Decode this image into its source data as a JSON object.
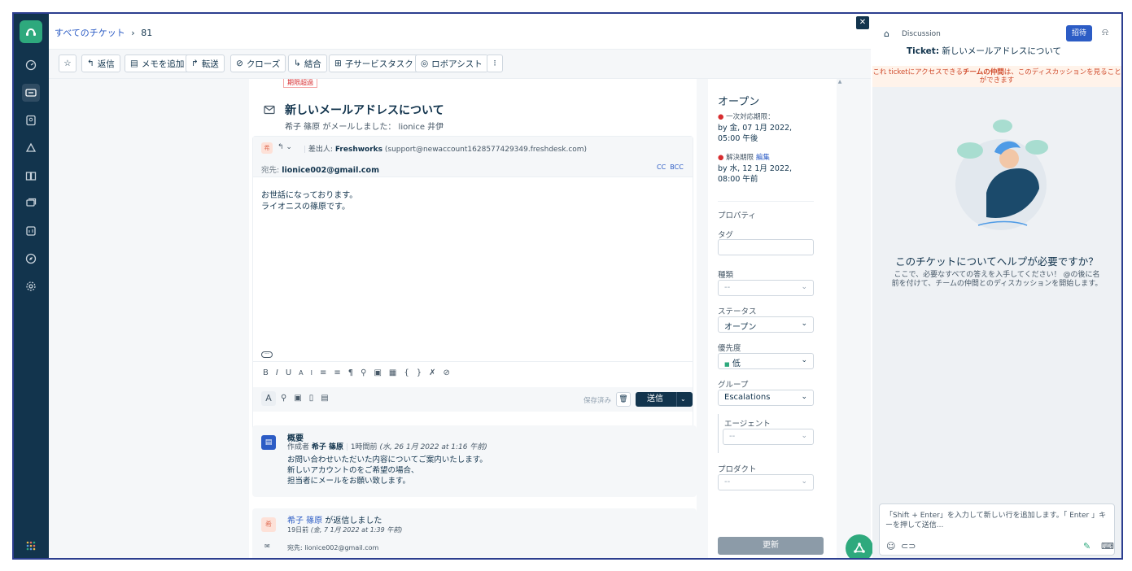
{
  "header": {
    "breadcrumb_all": "すべてのチケット",
    "breadcrumb_sep": "›",
    "ticket_number": "81"
  },
  "toolbar": {
    "reply": "返信",
    "add_note": "メモを追加",
    "forward": "転送",
    "close": "クローズ",
    "merge": "結合",
    "child_task": "子サービスタスク",
    "robo_assist": "ロボアシスト",
    "more": "⁝"
  },
  "ticket": {
    "overdue_badge": "期限超過",
    "subject": "新しいメールアドレスについて",
    "byline": "希子 篠原 がメールしました： lionice 井伊",
    "from_prefix": "差出人:",
    "from_name": "Freshworks",
    "from_email": "(support@newaccount1628577429349.freshdesk.com)",
    "to_label": "宛先:",
    "to_value": "lionice002@gmail.com",
    "cc": "CC",
    "bcc": "BCC",
    "body_line1": "お世話になっております。",
    "body_line2": "ライオニスの篠原です。",
    "saved": "保存済み",
    "send": "送信"
  },
  "summary": {
    "title": "概要",
    "author_prefix": "作成者",
    "author": "希子 篠原",
    "time": "1時間前",
    "time_detail": "(水, 26 1月 2022 at 1:16 午前)",
    "line1": "お問い合わせいただいた内容についてご案内いたします。",
    "line2": "新しいアカウントのをご希望の場合、",
    "line3": "担当者にメールをお願い致します。"
  },
  "reply_entry": {
    "author": "希子 篠原",
    "action": "が返信しました",
    "time": "19日前",
    "time_detail": "(金, 7 1月 2022 at 1:39 午前)",
    "to": "宛先: lionice002@gmail.com"
  },
  "properties": {
    "status_title": "オープン",
    "first_response_label": "一次対応期限：",
    "first_response_value": "by 金, 07 1月 2022, 05:00 午後",
    "resolution_label": "解決期限",
    "edit": "編集",
    "resolution_value": "by 水, 12 1月 2022, 08:00 午前",
    "section": "プロパティ",
    "tag_label": "タグ",
    "type_label": "種類",
    "type_value": "--",
    "status_label": "ステータス",
    "status_value": "オープン",
    "priority_label": "優先度",
    "priority_value": "低",
    "group_label": "グループ",
    "group_value": "Escalations",
    "agent_label": "エージェント",
    "agent_value": "--",
    "product_label": "プロダクト",
    "product_value": "--",
    "update": "更新"
  },
  "discussion": {
    "label": "Discussion",
    "invite": "招待",
    "ticket_prefix": "Ticket:",
    "ticket_title": "新しいメールアドレスについて",
    "banner_a": "これ ticketにアクセスできる",
    "banner_b": "チームの仲間",
    "banner_c": "は、このディスカッションを見ることができます",
    "help_title": "このチケットについてヘルプが必要ですか？",
    "help_line1": "ここで、必要なすべての答えを入手してください！ @の後に名",
    "help_line2": "前を付けて、チームの仲間とのディスカッションを開始します。",
    "input_line1": "「Shift + Enter」を入力して新しい行を追加します。「 Enter 」キ",
    "input_line2": "ーを押して送信..."
  },
  "colors": {
    "sidebar": "#12344d",
    "brand": "#2ea97d",
    "primary": "#12344d",
    "link": "#2c5cc5",
    "danger": "#d72d30"
  }
}
